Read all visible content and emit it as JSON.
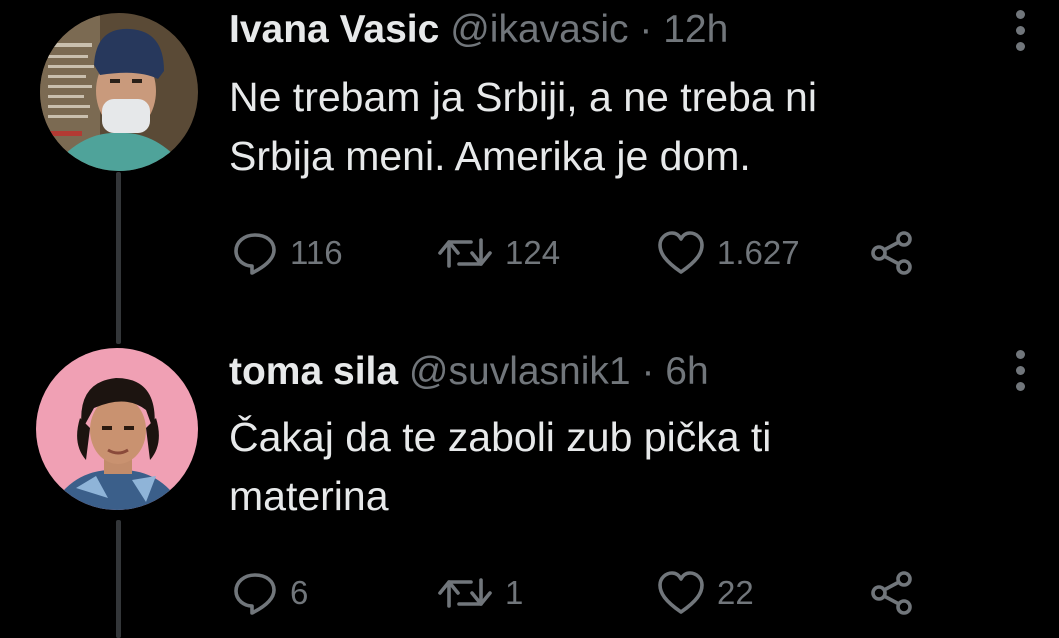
{
  "colors": {
    "background": "#000000",
    "text": "#e7e9ea",
    "secondary": "#71767b",
    "thread_line": "#333639"
  },
  "tweets": [
    {
      "name": "Ivana Vasic",
      "handle": "@ikavasic",
      "separator": "·",
      "time": "12h",
      "text": "Ne trebam ja Srbiji, a ne treba ni\nSrbija meni. Amerika je dom.",
      "replies": "116",
      "retweets": "124",
      "likes": "1.627",
      "icons": [
        "reply-icon",
        "retweet-icon",
        "like-icon",
        "share-icon",
        "more-icon"
      ]
    },
    {
      "name": "toma sila",
      "handle": "@suvlasnik1",
      "separator": "·",
      "time": "6h",
      "text": "Čakaj da te zaboli zub pička ti\nmaterina",
      "replies": "6",
      "retweets": "1",
      "likes": "22",
      "icons": [
        "reply-icon",
        "retweet-icon",
        "like-icon",
        "share-icon",
        "more-icon"
      ]
    }
  ]
}
